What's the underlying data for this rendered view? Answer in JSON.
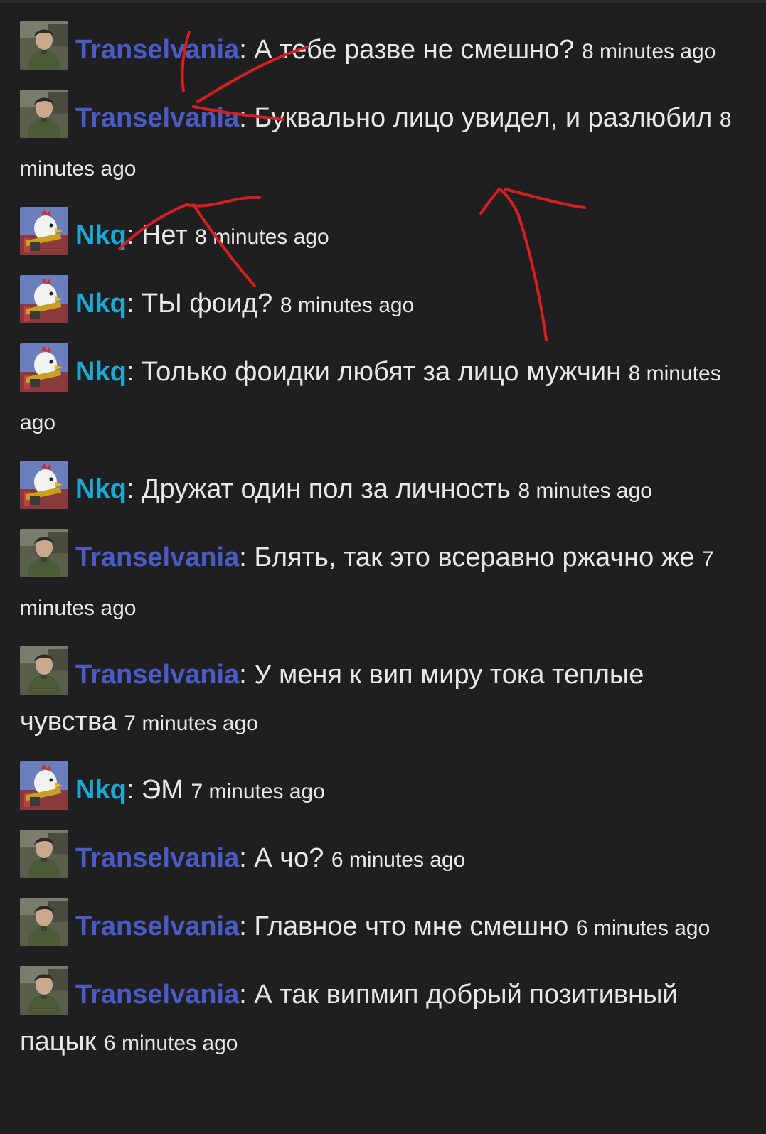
{
  "messages": [
    {
      "user": "Transelvania",
      "user_class": "trans",
      "avatar": "soldier-avatar",
      "text": "А тебе разве не смешно?",
      "time": "8 minutes ago"
    },
    {
      "user": "Transelvania",
      "user_class": "trans",
      "avatar": "soldier-avatar",
      "text": "Буквально лицо увидел, и разлюбил",
      "time": "8 minutes ago"
    },
    {
      "user": "Nkq",
      "user_class": "nkq",
      "avatar": "chicken-avatar",
      "text": "Нет",
      "time": "8 minutes ago"
    },
    {
      "user": "Nkq",
      "user_class": "nkq",
      "avatar": "chicken-avatar",
      "text": "ТЫ фоид?",
      "time": "8 minutes ago"
    },
    {
      "user": "Nkq",
      "user_class": "nkq",
      "avatar": "chicken-avatar",
      "text": "Только фоидки любят за лицо мужчин",
      "time": "8 minutes ago"
    },
    {
      "user": "Nkq",
      "user_class": "nkq",
      "avatar": "chicken-avatar",
      "text": "Дружат один пол за личность",
      "time": "8 minutes ago"
    },
    {
      "user": "Transelvania",
      "user_class": "trans",
      "avatar": "soldier-avatar",
      "text": "Блять, так это всеравно ржачно же",
      "time": "7 minutes ago"
    },
    {
      "user": "Transelvania",
      "user_class": "trans",
      "avatar": "soldier-avatar",
      "text": "У меня к вип миру тока теплые чувства",
      "time": "7 minutes ago"
    },
    {
      "user": "Nkq",
      "user_class": "nkq",
      "avatar": "chicken-avatar",
      "text": "ЭМ",
      "time": "7 minutes ago"
    },
    {
      "user": "Transelvania",
      "user_class": "trans",
      "avatar": "soldier-avatar",
      "text": "А чо?",
      "time": "6 minutes ago"
    },
    {
      "user": "Transelvania",
      "user_class": "trans",
      "avatar": "soldier-avatar",
      "text": "Главное что мне смешно",
      "time": "6 minutes ago"
    },
    {
      "user": "Transelvania",
      "user_class": "trans",
      "avatar": "soldier-avatar",
      "text": "А так випмип добрый позитивный пацык",
      "time": "6 minutes ago"
    }
  ],
  "colors": {
    "background": "#1f1f21",
    "transelvania": "#4b5bc4",
    "nkq": "#1ba9d4",
    "text": "#e8e8e8",
    "annotation_red": "#d42020"
  }
}
